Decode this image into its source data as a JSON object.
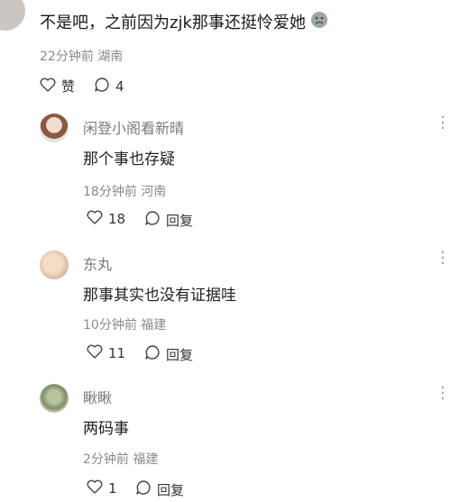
{
  "top_comment": {
    "text": "不是吧，之前因为zjk那事还挺怜爱她",
    "meta": "22分钟前  湖南",
    "like_label": "赞",
    "reply_count": "4"
  },
  "replies": [
    {
      "name": "闲登小阁看新晴",
      "text": "那个事也存疑",
      "meta": "18分钟前  河南",
      "likes": "18",
      "reply_label": "回复"
    },
    {
      "name": "东丸",
      "text": "那事其实也没有证据哇",
      "meta": "10分钟前  福建",
      "likes": "11",
      "reply_label": "回复"
    },
    {
      "name": "瞅瞅",
      "text": "两码事",
      "meta": "2分钟前  福建",
      "likes": "1",
      "reply_label": "回复"
    }
  ],
  "icons": {
    "like": "heart-outline-icon",
    "comment": "speech-bubble-icon",
    "more": "more-vertical-icon",
    "emoji": "crying-emoji-icon"
  },
  "colors": {
    "text_primary": "#1f1f1f",
    "text_meta": "#8a8a8a",
    "name": "#7a7a7a"
  }
}
